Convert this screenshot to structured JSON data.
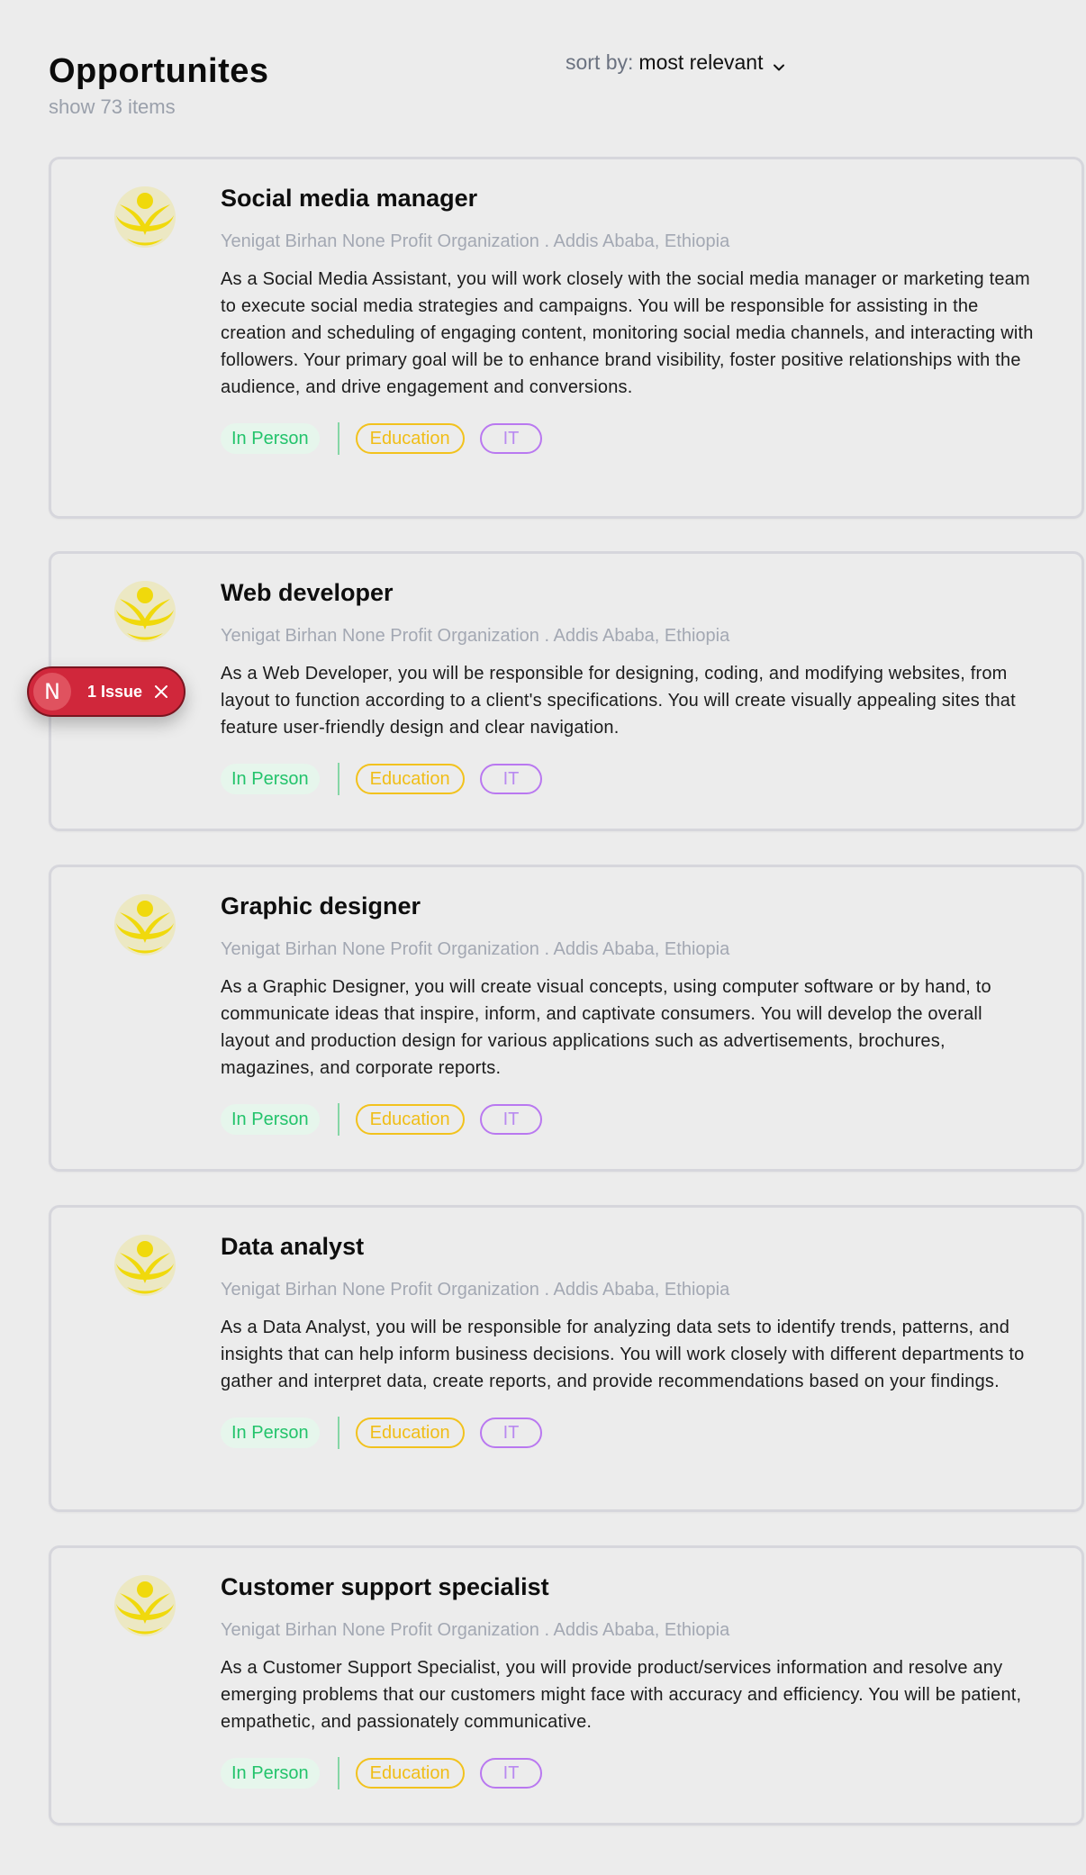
{
  "header": {
    "title": "Opportunites",
    "count_text": "show 73 items",
    "sort_label": "sort by:",
    "sort_value": "most relevant"
  },
  "colors": {
    "logo": "#f0d90c",
    "in_person_text": "#22c36b",
    "education": "#f2c21d",
    "it": "#b978f0",
    "issue": "#d0273b"
  },
  "jobs": [
    {
      "title": "Social media manager",
      "org": "Yenigat Birhan None Profit Organization . Addis Ababa, Ethiopia",
      "desc": "As a Social Media Assistant, you will work closely with the social media manager or marketing team to execute social media strategies and campaigns. You will be responsible for assisting in the creation and scheduling of engaging content, monitoring social media channels, and interacting with followers. Your primary goal will be to enhance brand visibility, foster positive relationships with the audience, and drive engagement and conversions.",
      "tags": [
        "In Person",
        "Education",
        "IT"
      ]
    },
    {
      "title": "Web developer",
      "org": "Yenigat Birhan None Profit Organization . Addis Ababa, Ethiopia",
      "desc": "As a Web Developer, you will be responsible for designing, coding, and modifying websites, from layout to function according to a client's specifications. You will create visually appealing sites that feature user-friendly design and clear navigation.",
      "tags": [
        "In Person",
        "Education",
        "IT"
      ]
    },
    {
      "title": "Graphic designer",
      "org": "Yenigat Birhan None Profit Organization . Addis Ababa, Ethiopia",
      "desc": "As a Graphic Designer, you will create visual concepts, using computer software or by hand, to communicate ideas that inspire, inform, and captivate consumers. You will develop the overall layout and production design for various applications such as advertisements, brochures, magazines, and corporate reports.",
      "tags": [
        "In Person",
        "Education",
        "IT"
      ]
    },
    {
      "title": "Data analyst",
      "org": "Yenigat Birhan None Profit Organization . Addis Ababa, Ethiopia",
      "desc": "As a Data Analyst, you will be responsible for analyzing data sets to identify trends, patterns, and insights that can help inform business decisions. You will work closely with different departments to gather and interpret data, create reports, and provide recommendations based on your findings.",
      "tags": [
        "In Person",
        "Education",
        "IT"
      ]
    },
    {
      "title": "Customer support specialist",
      "org": "Yenigat Birhan None Profit Organization . Addis Ababa, Ethiopia",
      "desc": "As a Customer Support Specialist, you will provide product/services information and resolve any emerging problems that our customers might face with accuracy and efficiency. You will be patient, empathetic, and passionately communicative.",
      "tags": [
        "In Person",
        "Education",
        "IT"
      ]
    }
  ],
  "issue_badge": {
    "letter": "N",
    "text": "1 Issue"
  }
}
